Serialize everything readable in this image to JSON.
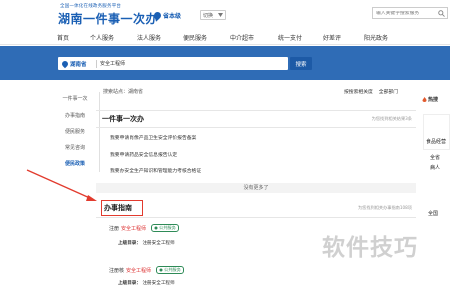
{
  "header": {
    "logo_small": "全国一体化在线政务服务平台",
    "logo_big": "湖南一件事一次办",
    "level": "省本级",
    "region_select": "切换",
    "search_placeholder": "输入关键字搜索服务"
  },
  "nav": [
    {
      "label": "首页"
    },
    {
      "label": "个人服务"
    },
    {
      "label": "法人服务"
    },
    {
      "label": "便民服务"
    },
    {
      "label": "中介超市"
    },
    {
      "label": "统一支付"
    },
    {
      "label": "好差评"
    },
    {
      "label": "阳光政务"
    }
  ],
  "search_banner": {
    "region": "湖南省",
    "query": "安全工程师",
    "button": "搜索"
  },
  "left_menu": [
    {
      "label": "一件事一次"
    },
    {
      "label": "办事指南",
      "active": false
    },
    {
      "label": "便民服务"
    },
    {
      "label": "常见咨询"
    },
    {
      "label": "便民政策",
      "active": true
    }
  ],
  "results_head": {
    "breadcrumb": "搜索站点：湖南省",
    "sort1": "按搜索相关度",
    "sort2": "全部部门"
  },
  "section_one": {
    "title": "一件事一次办",
    "note": "为您找到相关结果3条",
    "items": [
      "我要申请肖像产品卫生安全评价报告备案",
      "我要申请药品安全信息报告认定",
      "我要办安全生产知识和管理能力考核合格证"
    ],
    "more": "没有更多了"
  },
  "section_two": {
    "title": "办事指南",
    "note": "为您找到相关办事指南108项",
    "services": [
      {
        "prefix": "注册",
        "highlight": "安全工程师",
        "tag": "公共服务",
        "dept_label": "上级目录：",
        "dept_value": "注册安全工程师"
      },
      {
        "prefix": "注册核",
        "highlight": "安全工程师",
        "tag": "公共服务",
        "dept_label": "上级目录：",
        "dept_value": "注册安全工程师"
      }
    ]
  },
  "right_panel": {
    "hot": "热搜",
    "items": [
      "食品经营",
      "全省",
      "病人",
      "全国"
    ]
  },
  "watermark": "软件技巧",
  "colors": {
    "brand": "#1a5fb4",
    "banner": "#2f6cb6",
    "highlight": "#d33333",
    "annotation": "#e23b2e",
    "tag": "#2e8b57"
  }
}
